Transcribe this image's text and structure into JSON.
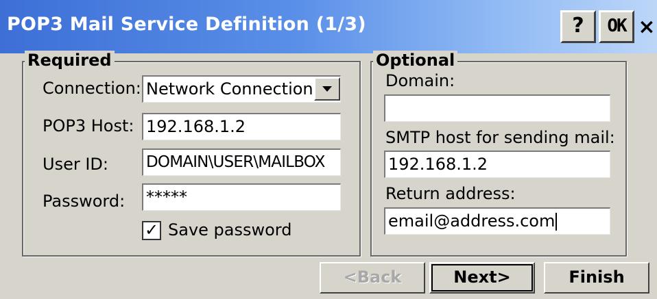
{
  "window": {
    "title": "POP3 Mail Service Definition (1/3)",
    "help_label": "?",
    "ok_label": "OK",
    "close_label": "×"
  },
  "required": {
    "legend": "Required",
    "connection": {
      "label": "Connection:",
      "value": "Network Connection"
    },
    "pop3_host": {
      "label": "POP3 Host:",
      "value": "192.168.1.2"
    },
    "user_id": {
      "label": "User ID:",
      "value": "DOMAIN\\USER\\MAILBOX"
    },
    "password": {
      "label": "Password:",
      "value": "*****"
    },
    "save_password": {
      "label": "Save password",
      "checked": true,
      "check_glyph": "✓"
    }
  },
  "optional": {
    "legend": "Optional",
    "domain": {
      "label": "Domain:",
      "value": ""
    },
    "smtp_host": {
      "label": "SMTP host for sending mail:",
      "value": "192.168.1.2"
    },
    "return_address": {
      "label": "Return address:",
      "value": "email@address.com"
    }
  },
  "buttons": {
    "back": "<Back",
    "next": "Next>",
    "finish": "Finish"
  },
  "colors": {
    "title_gradient_start": "#3d6fd6",
    "title_gradient_end": "#bcd6f8",
    "face": "#d7d4cc"
  }
}
